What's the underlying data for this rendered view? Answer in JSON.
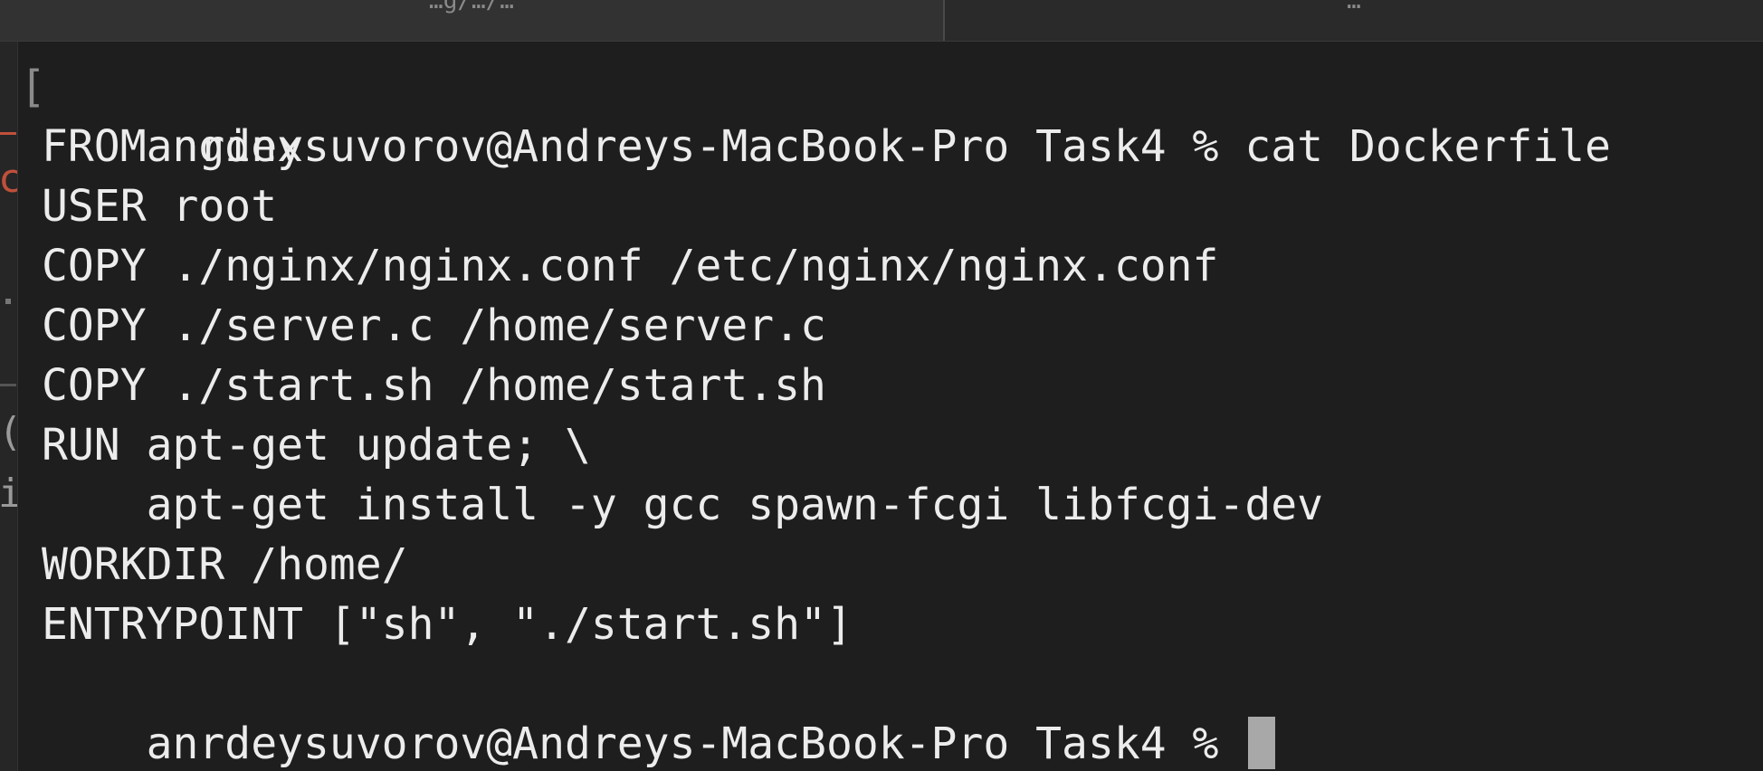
{
  "window": {
    "tabs": [
      {
        "label": "…g/…/…"
      },
      {
        "label": "…"
      }
    ]
  },
  "terminal": {
    "prompt": "anrdeysuvorov@Andreys-MacBook-Pro Task4 % ",
    "command": "cat Dockerfile",
    "output": [
      "FROM nginx",
      "USER root",
      "COPY ./nginx/nginx.conf /etc/nginx/nginx.conf",
      "COPY ./server.c /home/server.c",
      "COPY ./start.sh /home/start.sh",
      "RUN apt-get update; \\",
      "    apt-get install -y gcc spawn-fcgi libfcgi-dev",
      "WORKDIR /home/",
      "ENTRYPOINT [\"sh\", \"./start.sh\"]"
    ],
    "final_prompt": "anrdeysuvorov@Andreys-MacBook-Pro Task4 % "
  },
  "left_strip": {
    "fragments": [
      "c",
      "(",
      "i"
    ]
  },
  "colors": {
    "background": "#1e1e1e",
    "text": "#ececec",
    "cursor": "#a8a8a8",
    "accent_mark": "#c0503a"
  }
}
